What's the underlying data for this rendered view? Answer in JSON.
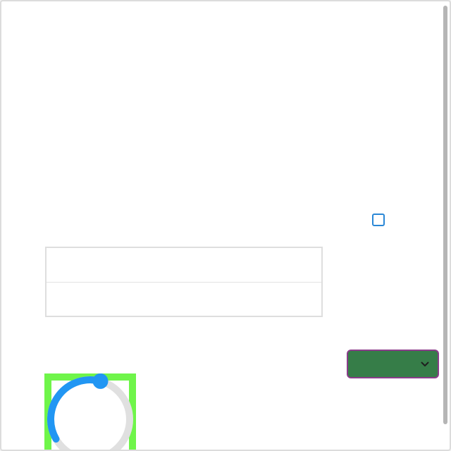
{
  "window": {
    "background": "#ffffff",
    "border_color": "#dcdcdc"
  },
  "checkbox": {
    "checked": false,
    "accent": "#2a87d6"
  },
  "table": {
    "rows": [
      {
        "text": ""
      },
      {
        "text": ""
      }
    ]
  },
  "dropdown": {
    "selected": "",
    "background": "#367d48",
    "border": "#8a3c8a",
    "icon": "chevron-down-icon"
  },
  "dial": {
    "value_fraction": 0.45,
    "track_color": "#e0e0e0",
    "fill_color": "#2196f3",
    "frame_color": "#6ff54a"
  }
}
